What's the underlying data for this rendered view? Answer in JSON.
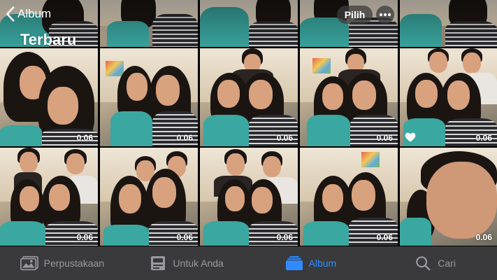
{
  "header": {
    "back_label": "Album",
    "title": "Terbaru",
    "select_label": "Pilih"
  },
  "grid": {
    "items": [
      {
        "duration": ""
      },
      {
        "duration": ""
      },
      {
        "duration": ""
      },
      {
        "duration": ""
      },
      {
        "duration": ""
      },
      {
        "duration": "0.06"
      },
      {
        "duration": "0.06"
      },
      {
        "duration": "0.06"
      },
      {
        "duration": "0.06"
      },
      {
        "duration": "0.06",
        "favorite": true
      },
      {
        "duration": "0.06"
      },
      {
        "duration": "0.06"
      },
      {
        "duration": "0.06"
      },
      {
        "duration": "0.06"
      },
      {
        "duration": "0.06"
      }
    ]
  },
  "tabs": [
    {
      "label": "Perpustakaan",
      "icon": "photos-library-icon",
      "active": false
    },
    {
      "label": "Untuk Anda",
      "icon": "for-you-icon",
      "active": false
    },
    {
      "label": "Album",
      "icon": "albums-icon",
      "active": true
    },
    {
      "label": "Cari",
      "icon": "search-icon",
      "active": false
    }
  ],
  "colors": {
    "accent": "#2f8bff",
    "tabbar_bg": "#3a3a3c",
    "tab_inactive": "#9a9a9e"
  }
}
